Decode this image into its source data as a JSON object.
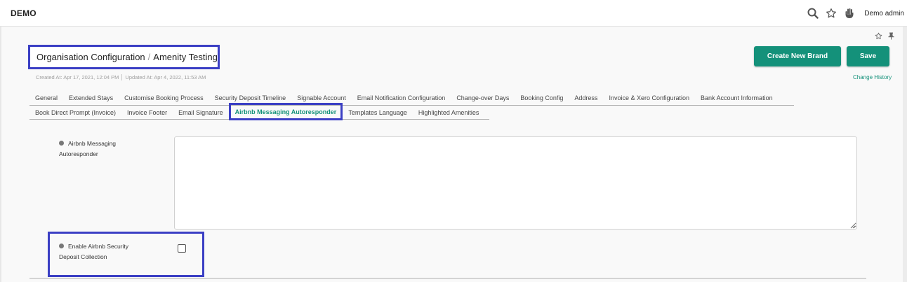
{
  "topbar": {
    "brand": "DEMO",
    "user_name": "Demo admin",
    "icons": [
      "search-icon",
      "star-icon",
      "hand-icon"
    ]
  },
  "header": {
    "breadcrumb_parent": "Organisation Configuration",
    "breadcrumb_separator": "/",
    "breadcrumb_current": "Amenity Testing",
    "created_at": "Created At: Apr 17, 2021, 12:04 PM",
    "updated_at": "Updated At: Apr 4, 2022, 11:53 AM",
    "create_brand_label": "Create New Brand",
    "save_label": "Save",
    "change_history_label": "Change History"
  },
  "tabs": {
    "row1": [
      {
        "label": "General"
      },
      {
        "label": "Extended Stays"
      },
      {
        "label": "Customise Booking Process"
      },
      {
        "label": "Security Deposit Timeline"
      },
      {
        "label": "Signable Account"
      },
      {
        "label": "Email Notification Configuration"
      },
      {
        "label": "Change-over Days"
      },
      {
        "label": "Booking Config"
      },
      {
        "label": "Address"
      },
      {
        "label": "Invoice & Xero Configuration"
      },
      {
        "label": "Bank Account Information"
      }
    ],
    "row2": [
      {
        "label": "Book Direct Prompt (Invoice)"
      },
      {
        "label": "Invoice Footer"
      },
      {
        "label": "Email Signature"
      },
      {
        "label": "Airbnb Messaging Autoresponder",
        "active": true
      },
      {
        "label": "Templates Language"
      },
      {
        "label": "Highlighted Amenities"
      }
    ]
  },
  "form": {
    "autoresponder_label": "Airbnb Messaging Autoresponder",
    "autoresponder_value": "",
    "security_label": "Enable Airbnb Security Deposit Collection",
    "security_checked": false
  },
  "colors": {
    "accent": "#14917a",
    "highlight_border": "#3b3fc4"
  }
}
